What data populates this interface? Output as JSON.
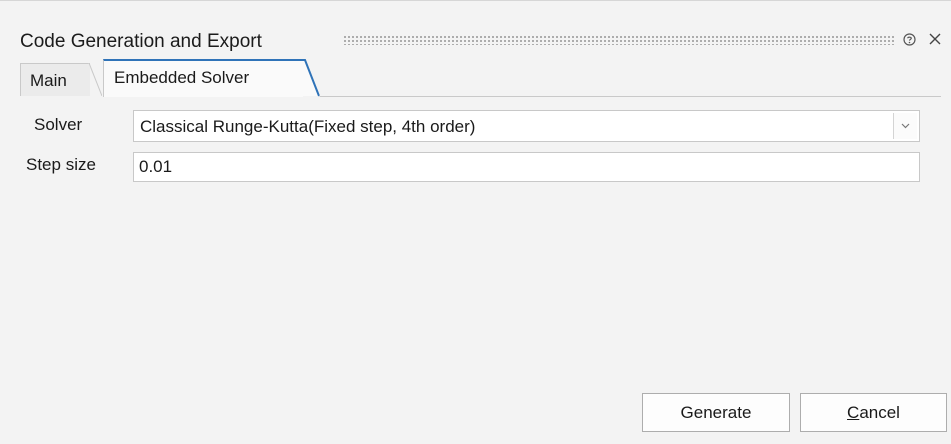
{
  "window": {
    "title": "Code Generation and Export"
  },
  "titlebar_icons": [
    "help-icon",
    "close-icon"
  ],
  "tabs": [
    {
      "label": "Main",
      "selected": false
    },
    {
      "label": "Embedded Solver",
      "selected": true
    }
  ],
  "form": {
    "solver_label": "Solver",
    "solver_value": "Classical Runge-Kutta(Fixed step, 4th order)",
    "step_size_label": "Step size",
    "step_size_value": "0.01"
  },
  "buttons": {
    "generate_label": "Generate",
    "cancel_mnemonic": "C",
    "cancel_rest": "ancel"
  },
  "colors": {
    "accent": "#2f73b8",
    "background": "#f3f3f3"
  }
}
